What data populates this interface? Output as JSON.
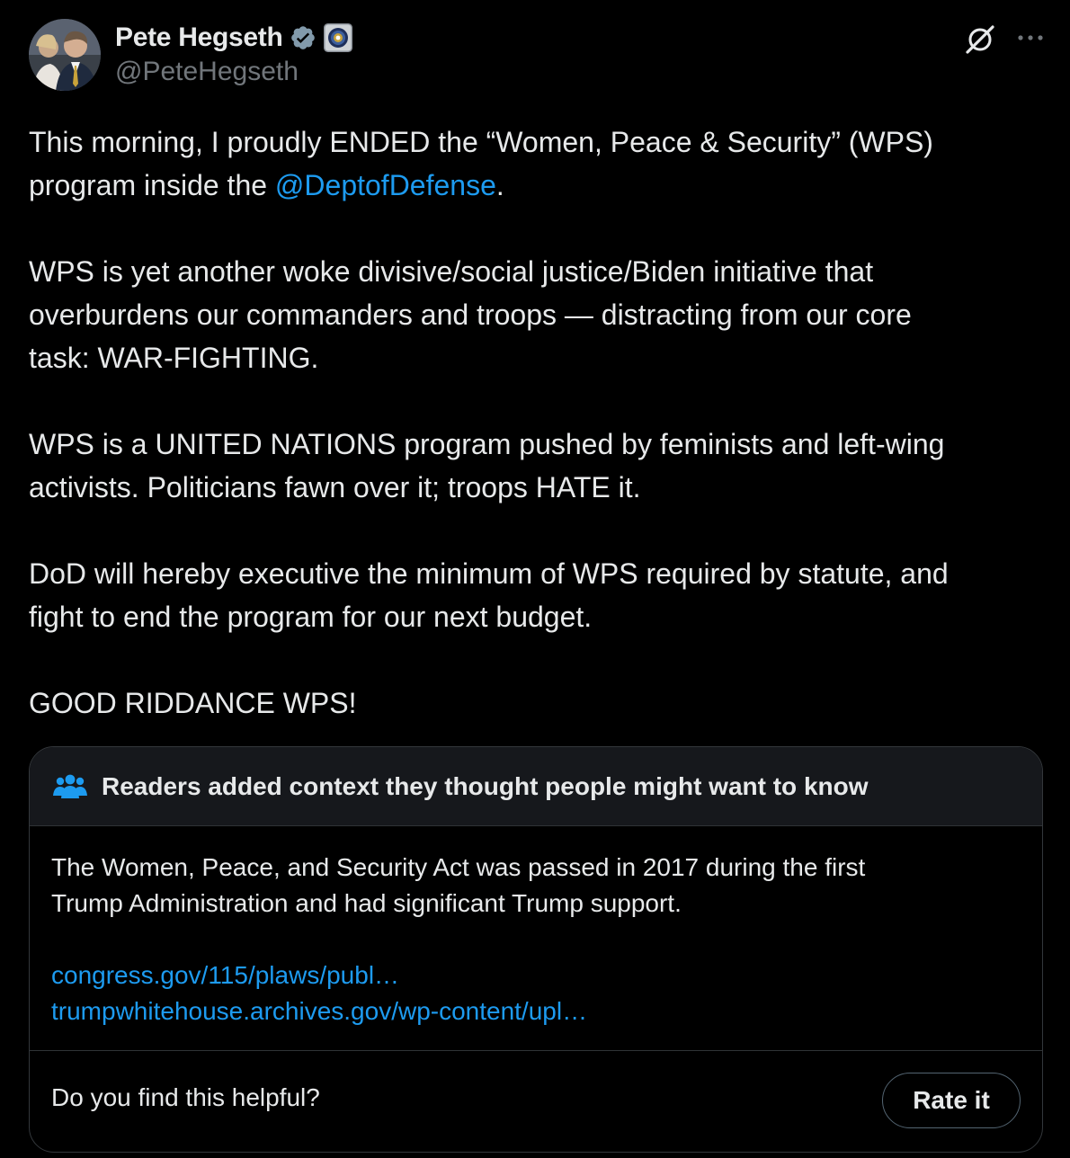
{
  "author": {
    "display_name": "Pete Hegseth",
    "handle": "@PeteHegseth"
  },
  "icons": {
    "verified": "verified-badge-icon",
    "affiliation": "dod-seal-icon",
    "grok": "grok-icon",
    "more": "more-options-icon",
    "community": "community-notes-people-icon"
  },
  "tweet": {
    "p1_before": "This morning, I proudly ENDED the “Women, Peace & Security” (WPS)",
    "p1_line2_before": "program inside the ",
    "p1_mention": "@DeptofDefense",
    "p1_after": ".",
    "p2_line1": "WPS is yet another woke divisive/social justice/Biden initiative that",
    "p2_line2": "overburdens our commanders and troops — distracting from our core",
    "p2_line3": "task: WAR-FIGHTING.",
    "p3_line1": "WPS is a UNITED NATIONS program pushed by feminists and left-wing",
    "p3_line2": "activists. Politicians fawn over it; troops HATE it.",
    "p4_line1": "DoD will hereby executive the minimum of WPS required by statute, and",
    "p4_line2": "fight to end the program for our next budget.",
    "p5": "GOOD RIDDANCE WPS!"
  },
  "community_note": {
    "title": "Readers added context they thought people might want to know",
    "body_line1": "The Women, Peace, and Security Act was passed in 2017 during the first",
    "body_line2": "Trump Administration and had significant Trump support.",
    "links": [
      "congress.gov/115/plaws/publ…",
      "trumpwhitehouse.archives.gov/wp-content/upl…"
    ],
    "helpful_question": "Do you find this helpful?",
    "rate_label": "Rate it"
  },
  "colors": {
    "background": "#000000",
    "text": "#e7e9ea",
    "muted": "#71767b",
    "link": "#1d9bf0",
    "note_header_bg": "#16181c",
    "border": "#2f3336"
  }
}
